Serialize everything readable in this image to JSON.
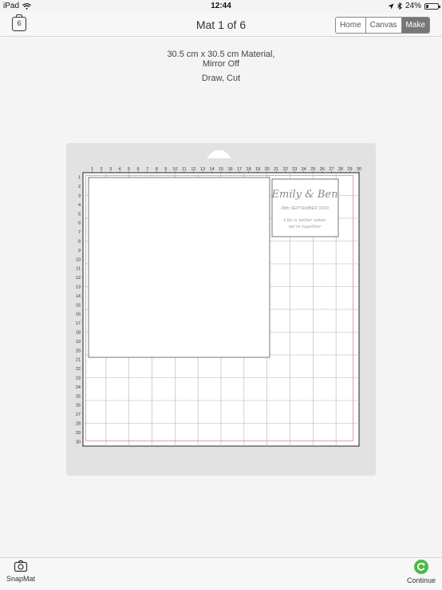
{
  "status_bar": {
    "device": "iPad",
    "time": "12:44",
    "battery": "24%",
    "battery_level": 0.24
  },
  "nav": {
    "mats_badge": "6",
    "title": "Mat 1 of 6",
    "segments": [
      "Home",
      "Canvas",
      "Make"
    ],
    "active_segment": "Make"
  },
  "info": {
    "material_line1": "30.5 cm x 30.5 cm Material,",
    "material_line2": "Mirror Off",
    "operations": "Draw, Cut"
  },
  "mat": {
    "columns": [
      "1",
      "2",
      "3",
      "4",
      "5",
      "6",
      "7",
      "8",
      "9",
      "10",
      "11",
      "12",
      "13",
      "14",
      "15",
      "16",
      "17",
      "18",
      "19",
      "20",
      "21",
      "22",
      "23",
      "24",
      "25",
      "26",
      "27",
      "28",
      "29",
      "30"
    ],
    "rows": [
      "1",
      "2",
      "3",
      "4",
      "5",
      "6",
      "7",
      "8",
      "9",
      "10",
      "11",
      "12",
      "13",
      "14",
      "15",
      "16",
      "17",
      "18",
      "19",
      "20",
      "21",
      "22",
      "23",
      "24",
      "25",
      "26",
      "27",
      "28",
      "29",
      "30"
    ],
    "card": {
      "names": "Emily & Ben",
      "date": "28th SEPTEMBER 2019",
      "quote_line1": "Life is better when",
      "quote_line2": "we're together"
    }
  },
  "bottom": {
    "snapmat_label": "SnapMat",
    "continue_label": "Continue"
  },
  "colors": {
    "accent_green": "#4db848",
    "mat_border": "#e88a8a",
    "mat_background": "#e2e2e2"
  }
}
